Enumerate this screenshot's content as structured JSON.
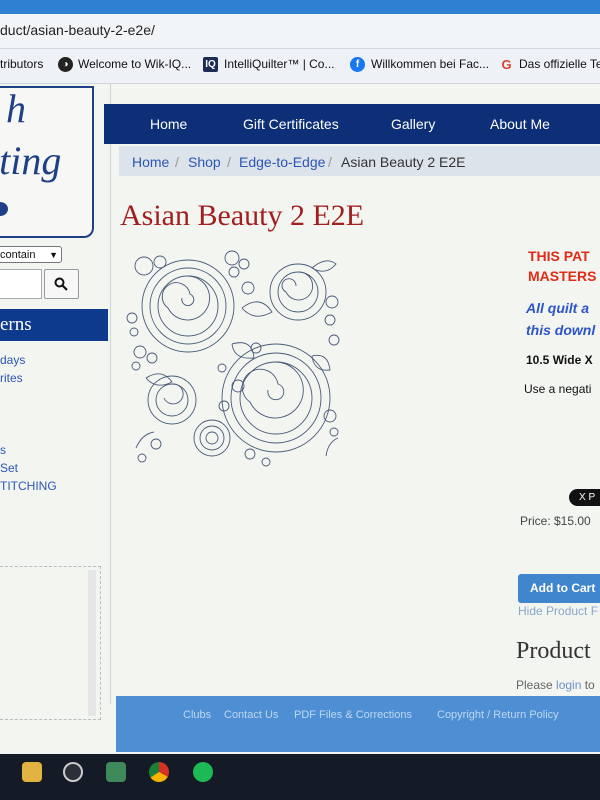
{
  "browser": {
    "url": "duct/asian-beauty-2-e2e/",
    "bookmarks": [
      {
        "label": "tributors",
        "icon": "folder-icon"
      },
      {
        "label": "Welcome to Wik-IQ...",
        "icon": "wik-iq-icon"
      },
      {
        "label": "IntelliQuilter™ | Co...",
        "icon": "intelliquilter-icon",
        "icon_text": "IQ"
      },
      {
        "label": "Willkommen bei Fac...",
        "icon": "facebook-icon",
        "icon_text": "f"
      },
      {
        "label": "Das offizielle Te",
        "icon": "google-icon",
        "icon_text": "G"
      }
    ]
  },
  "sidebar": {
    "logo_lines": [
      "h",
      "lting"
    ],
    "search_select": "contain",
    "category_header": "erns",
    "links_a": [
      "days",
      "rites"
    ],
    "links_b": [
      "s",
      "Set",
      "TITCHING"
    ]
  },
  "nav": {
    "items": [
      "Home",
      "Gift Certificates",
      "Gallery",
      "About Me"
    ]
  },
  "breadcrumb": {
    "items": [
      "Home",
      "Shop",
      "Edge-to-Edge",
      "Asian Beauty 2 E2E"
    ],
    "separator": "/"
  },
  "product": {
    "title": "Asian Beauty 2 E2E",
    "notice_red": [
      "THIS PAT",
      "MASTERS"
    ],
    "notice_blue": [
      "All quilt a",
      "this downl"
    ],
    "size": "10.5 Wide X",
    "usage": "Use a negati",
    "share_label": "X P",
    "price": "Price: $15.00",
    "add_to_cart": "Add to Cart",
    "hide_link": "Hide Product F",
    "section_heading": "Product",
    "login_prefix": "Please ",
    "login_link": "login",
    "login_suffix": " to"
  },
  "footer": {
    "links": [
      "Clubs",
      "Contact Us",
      "PDF Files & Corrections",
      "Copyright / Return Policy"
    ]
  },
  "taskbar": {
    "icons": [
      "file-explorer-icon",
      "vpn-icon",
      "security-shield-icon",
      "chrome-icon",
      "spotify-icon"
    ]
  },
  "colors": {
    "nav_bg": "#0d2f78",
    "title_red": "#a11f1f",
    "cart_blue": "#3f86cc",
    "footer_blue": "#4e8ed2"
  }
}
